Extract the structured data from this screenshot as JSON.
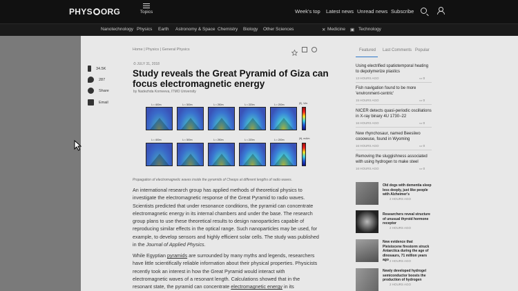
{
  "header": {
    "logo": "PHYS ORG",
    "logo_left": "PHYS",
    "logo_right": "ORG",
    "topics": "Topics",
    "nav": [
      "Week's top",
      "Latest news",
      "Unread news",
      "Subscribe"
    ]
  },
  "categories": [
    "Nanotechnology",
    "Physics",
    "Earth",
    "Astronomy & Space",
    "Chemistry",
    "Biology",
    "Other Sciences",
    "Medicine",
    "Technology"
  ],
  "article": {
    "breadcrumb": "Home | Physics | General Physics",
    "date": "JULY 31, 2018",
    "title": "Study reveals the Great Pyramid of Giza can focus electromagnetic energy",
    "byline": "by Nadezhda Korneeva, ITMO University",
    "caption": "Propagation of electromagnetic waves inside the pyramids of Cheops at different lengths of radio waves.",
    "paragraph1": "An international research group has applied methods of theoretical physics to investigate the electromagnetic response of the Great Pyramid to radio waves. Scientists predicted that under resonance conditions, the pyramid can concentrate electromagnetic energy in its internal chambers and under the base. The research group plans to use these theoretical results to design nanoparticles capable of reproducing similar effects in the optical range. Such nanoparticles may be used, for example, to develop sensors and highly efficient solar cells. The study was published in the",
    "journal": "Journal of Applied Physics",
    "paragraph2_a": "While Egyptian",
    "paragraph2_link1": "pyramids",
    "paragraph2_b": "are surrounded by many myths and legends, researchers have little scientifically reliable information about their physical properties. Physicists recently took an interest in how the Great Pyramid would interact with electromagnetic waves of a resonant length. Calculations showed that in the resonant state, the pyramid can concentrate",
    "paragraph2_link2": "electromagnetic energy",
    "paragraph2_c": "in its"
  },
  "figure": {
    "top_labels": [
      "λ = 400m",
      "λ = 300m",
      "λ = 250m",
      "λ = 220m",
      "λ = 200m"
    ],
    "bottom_labels": [
      "λ = 400m",
      "λ = 300m",
      "λ = 250m",
      "λ = 220m",
      "λ = 200m"
    ],
    "top_unit": "|E|, V/m",
    "bottom_unit": "|H|, mA/m"
  },
  "social": [
    {
      "label": "34.5K",
      "icon": "facebook-icon"
    },
    {
      "label": "287",
      "icon": "twitter-icon"
    },
    {
      "label": "Share",
      "icon": "share-icon"
    },
    {
      "label": "Email",
      "icon": "email-icon"
    }
  ],
  "sidebar": {
    "tabs": [
      "Featured",
      "Last Comments",
      "Popular"
    ],
    "items": [
      {
        "title": "Using electrified spatiotemporal heating to depolymerize plastics",
        "time": "13 HOURS AGO",
        "comments": "0"
      },
      {
        "title": "Fish navigation found to be more 'environment-centric'",
        "time": "15 HOURS AGO",
        "comments": "0"
      },
      {
        "title": "NICER detects quasi-periodic oscillations in X-ray binary 4U 1730−22",
        "time": "16 HOURS AGO",
        "comments": "0"
      },
      {
        "title": "New rhynchosaur, named Beesiiwo cooowuse, found in Wyoming",
        "time": "16 HOURS AGO",
        "comments": "0"
      },
      {
        "title": "Removing the sluggishness associated with using hydrogen to make steel",
        "time": "16 HOURS AGO",
        "comments": "0"
      }
    ],
    "thumbs": [
      {
        "title": "Old dogs with dementia sleep less deeply, just like people with Alzheimer's",
        "time": "2 HOURS AGO"
      },
      {
        "title": "Researchers reveal structure of unusual thyroid hormone receptor",
        "time": "2 HOURS AGO"
      },
      {
        "title": "New evidence that Pleistocene firestorm struck Antarctica during the age of dinosaurs, 71 million years ago",
        "time": "2 HOURS AGO"
      },
      {
        "title": "Newly developed hydrogel semiconductor boosts the production of hydrogen",
        "time": "2 HOURS AGO"
      }
    ]
  }
}
